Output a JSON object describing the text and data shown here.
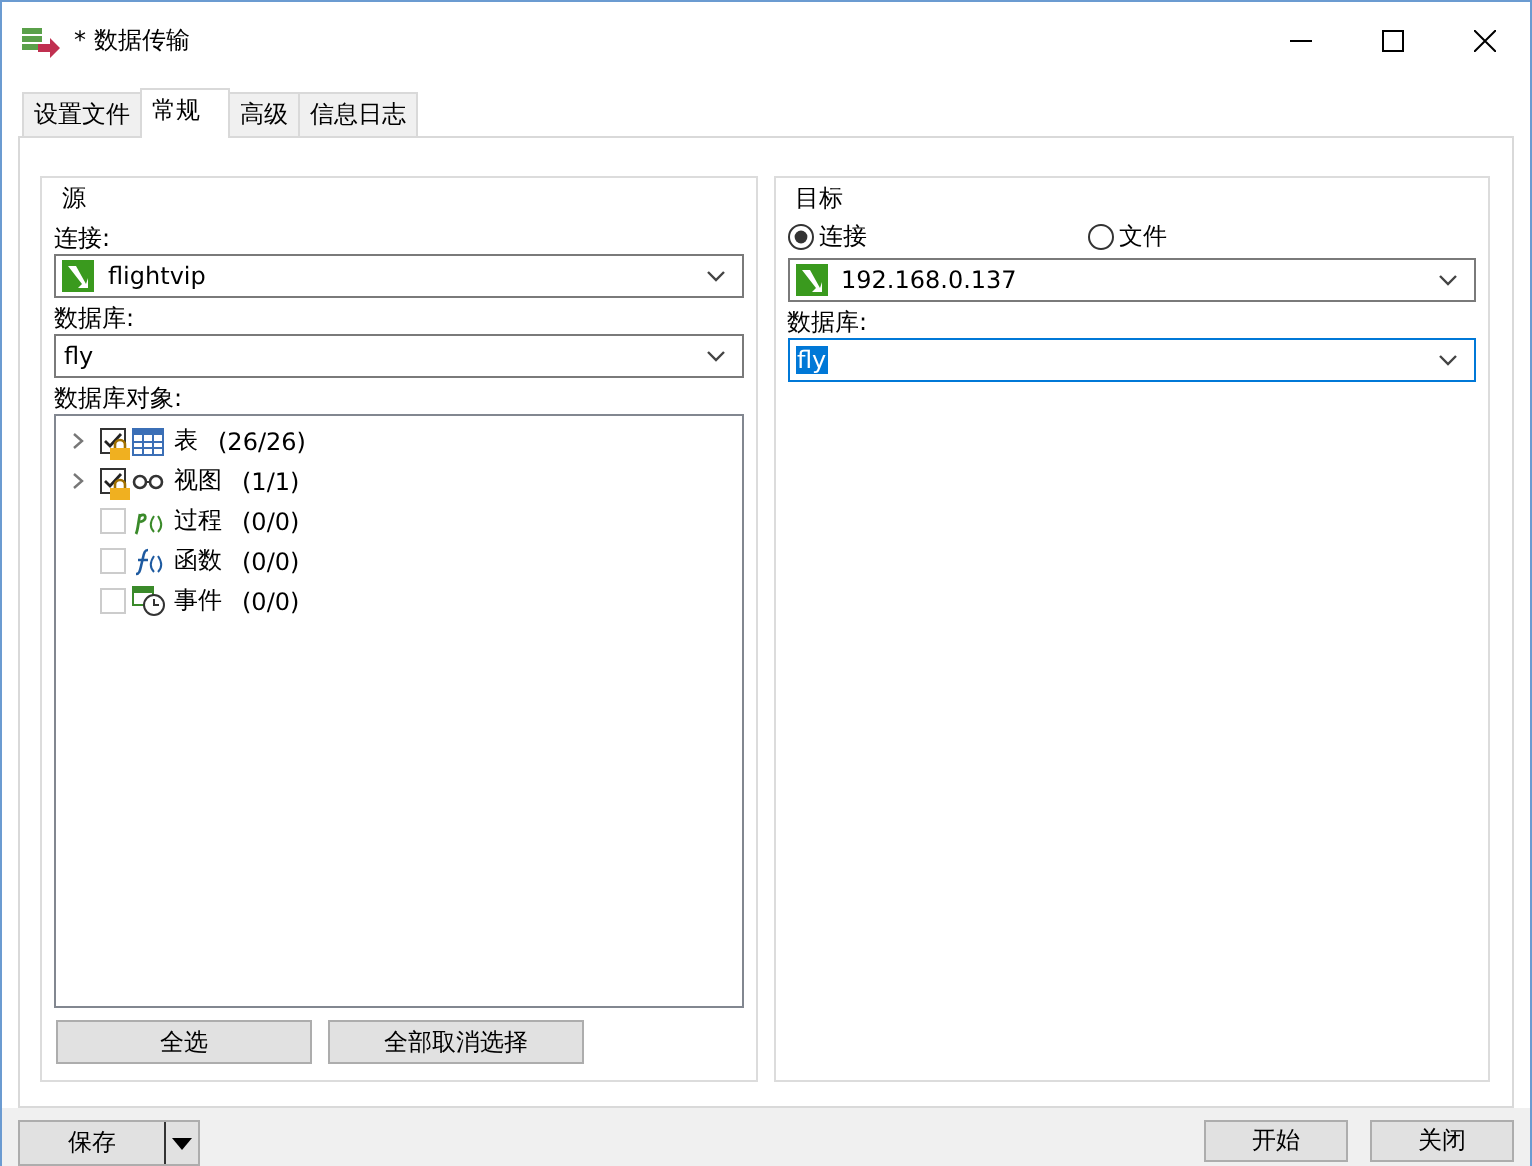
{
  "window": {
    "title": "* 数据传输"
  },
  "tabs": [
    {
      "label": "设置文件",
      "selected": false
    },
    {
      "label": "常规",
      "selected": true
    },
    {
      "label": "高级",
      "selected": false
    },
    {
      "label": "信息日志",
      "selected": false
    }
  ],
  "source": {
    "title": "源",
    "connection_label": "连接:",
    "connection": "flightvip",
    "database_label": "数据库:",
    "database": "fly",
    "objects_label": "数据库对象:",
    "objects": [
      {
        "kind": "table",
        "label": "表",
        "count": "(26/26)",
        "checked": true,
        "expandable": true
      },
      {
        "kind": "view",
        "label": "视图",
        "count": "(1/1)",
        "checked": true,
        "expandable": true
      },
      {
        "kind": "procedure",
        "label": "过程",
        "count": "(0/0)",
        "checked": false,
        "expandable": false
      },
      {
        "kind": "function",
        "label": "函数",
        "count": "(0/0)",
        "checked": false,
        "expandable": false
      },
      {
        "kind": "event",
        "label": "事件",
        "count": "(0/0)",
        "checked": false,
        "expandable": false
      }
    ],
    "buttons": [
      "全选",
      "全部取消选择"
    ]
  },
  "target": {
    "title": "目标",
    "modes": [
      {
        "label": "连接",
        "selected": true
      },
      {
        "label": "文件",
        "selected": false
      }
    ],
    "connection": "192.168.0.137",
    "database_label": "数据库:",
    "database": "fly",
    "database_focused": true
  },
  "footer": {
    "save": "保存",
    "buttons": [
      "开始",
      "关闭"
    ]
  }
}
